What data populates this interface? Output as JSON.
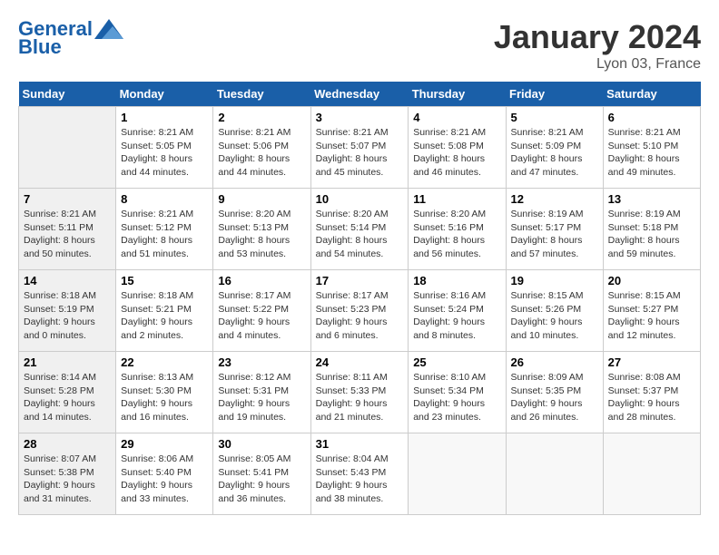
{
  "header": {
    "logo_line1": "General",
    "logo_line2": "Blue",
    "month": "January 2024",
    "location": "Lyon 03, France"
  },
  "weekdays": [
    "Sunday",
    "Monday",
    "Tuesday",
    "Wednesday",
    "Thursday",
    "Friday",
    "Saturday"
  ],
  "weeks": [
    [
      {
        "day": "",
        "info": ""
      },
      {
        "day": "1",
        "info": "Sunrise: 8:21 AM\nSunset: 5:05 PM\nDaylight: 8 hours\nand 44 minutes."
      },
      {
        "day": "2",
        "info": "Sunrise: 8:21 AM\nSunset: 5:06 PM\nDaylight: 8 hours\nand 44 minutes."
      },
      {
        "day": "3",
        "info": "Sunrise: 8:21 AM\nSunset: 5:07 PM\nDaylight: 8 hours\nand 45 minutes."
      },
      {
        "day": "4",
        "info": "Sunrise: 8:21 AM\nSunset: 5:08 PM\nDaylight: 8 hours\nand 46 minutes."
      },
      {
        "day": "5",
        "info": "Sunrise: 8:21 AM\nSunset: 5:09 PM\nDaylight: 8 hours\nand 47 minutes."
      },
      {
        "day": "6",
        "info": "Sunrise: 8:21 AM\nSunset: 5:10 PM\nDaylight: 8 hours\nand 49 minutes."
      }
    ],
    [
      {
        "day": "7",
        "info": "Sunrise: 8:21 AM\nSunset: 5:11 PM\nDaylight: 8 hours\nand 50 minutes."
      },
      {
        "day": "8",
        "info": "Sunrise: 8:21 AM\nSunset: 5:12 PM\nDaylight: 8 hours\nand 51 minutes."
      },
      {
        "day": "9",
        "info": "Sunrise: 8:20 AM\nSunset: 5:13 PM\nDaylight: 8 hours\nand 53 minutes."
      },
      {
        "day": "10",
        "info": "Sunrise: 8:20 AM\nSunset: 5:14 PM\nDaylight: 8 hours\nand 54 minutes."
      },
      {
        "day": "11",
        "info": "Sunrise: 8:20 AM\nSunset: 5:16 PM\nDaylight: 8 hours\nand 56 minutes."
      },
      {
        "day": "12",
        "info": "Sunrise: 8:19 AM\nSunset: 5:17 PM\nDaylight: 8 hours\nand 57 minutes."
      },
      {
        "day": "13",
        "info": "Sunrise: 8:19 AM\nSunset: 5:18 PM\nDaylight: 8 hours\nand 59 minutes."
      }
    ],
    [
      {
        "day": "14",
        "info": "Sunrise: 8:18 AM\nSunset: 5:19 PM\nDaylight: 9 hours\nand 0 minutes."
      },
      {
        "day": "15",
        "info": "Sunrise: 8:18 AM\nSunset: 5:21 PM\nDaylight: 9 hours\nand 2 minutes."
      },
      {
        "day": "16",
        "info": "Sunrise: 8:17 AM\nSunset: 5:22 PM\nDaylight: 9 hours\nand 4 minutes."
      },
      {
        "day": "17",
        "info": "Sunrise: 8:17 AM\nSunset: 5:23 PM\nDaylight: 9 hours\nand 6 minutes."
      },
      {
        "day": "18",
        "info": "Sunrise: 8:16 AM\nSunset: 5:24 PM\nDaylight: 9 hours\nand 8 minutes."
      },
      {
        "day": "19",
        "info": "Sunrise: 8:15 AM\nSunset: 5:26 PM\nDaylight: 9 hours\nand 10 minutes."
      },
      {
        "day": "20",
        "info": "Sunrise: 8:15 AM\nSunset: 5:27 PM\nDaylight: 9 hours\nand 12 minutes."
      }
    ],
    [
      {
        "day": "21",
        "info": "Sunrise: 8:14 AM\nSunset: 5:28 PM\nDaylight: 9 hours\nand 14 minutes."
      },
      {
        "day": "22",
        "info": "Sunrise: 8:13 AM\nSunset: 5:30 PM\nDaylight: 9 hours\nand 16 minutes."
      },
      {
        "day": "23",
        "info": "Sunrise: 8:12 AM\nSunset: 5:31 PM\nDaylight: 9 hours\nand 19 minutes."
      },
      {
        "day": "24",
        "info": "Sunrise: 8:11 AM\nSunset: 5:33 PM\nDaylight: 9 hours\nand 21 minutes."
      },
      {
        "day": "25",
        "info": "Sunrise: 8:10 AM\nSunset: 5:34 PM\nDaylight: 9 hours\nand 23 minutes."
      },
      {
        "day": "26",
        "info": "Sunrise: 8:09 AM\nSunset: 5:35 PM\nDaylight: 9 hours\nand 26 minutes."
      },
      {
        "day": "27",
        "info": "Sunrise: 8:08 AM\nSunset: 5:37 PM\nDaylight: 9 hours\nand 28 minutes."
      }
    ],
    [
      {
        "day": "28",
        "info": "Sunrise: 8:07 AM\nSunset: 5:38 PM\nDaylight: 9 hours\nand 31 minutes."
      },
      {
        "day": "29",
        "info": "Sunrise: 8:06 AM\nSunset: 5:40 PM\nDaylight: 9 hours\nand 33 minutes."
      },
      {
        "day": "30",
        "info": "Sunrise: 8:05 AM\nSunset: 5:41 PM\nDaylight: 9 hours\nand 36 minutes."
      },
      {
        "day": "31",
        "info": "Sunrise: 8:04 AM\nSunset: 5:43 PM\nDaylight: 9 hours\nand 38 minutes."
      },
      {
        "day": "",
        "info": ""
      },
      {
        "day": "",
        "info": ""
      },
      {
        "day": "",
        "info": ""
      }
    ]
  ]
}
